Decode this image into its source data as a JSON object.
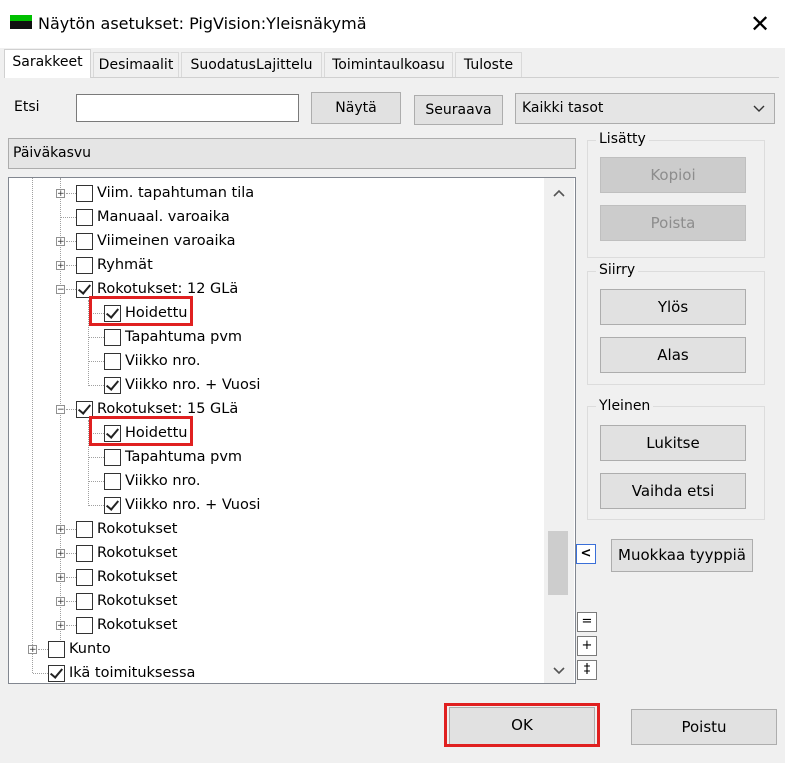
{
  "window": {
    "title": "Näytön asetukset: PigVision:Yleisnäkymä",
    "close_glyph": "✕"
  },
  "tabs": [
    {
      "label": "Sarakkeet"
    },
    {
      "label": "Desimaalit"
    },
    {
      "label": "SuodatusLajittelu"
    },
    {
      "label": "Toimintaulkoasu"
    },
    {
      "label": "Tuloste"
    }
  ],
  "active_tab": "Sarakkeet",
  "search": {
    "label": "Etsi",
    "value": "",
    "show_label": "Näytä",
    "next_label": "Seuraava",
    "level_value": "Kaikki tasot"
  },
  "group_header": "Päiväkasvu",
  "tree": {
    "items": [
      {
        "label": "Viim. tapahtuman tila",
        "checked": false,
        "expandable": true
      },
      {
        "label": "Manuaal. varoaika",
        "checked": false,
        "expandable": false
      },
      {
        "label": "Viimeinen varoaika",
        "checked": false,
        "expandable": true
      },
      {
        "label": "Ryhmät",
        "checked": false,
        "expandable": true
      },
      {
        "label": "Rokotukset: 12 GLä",
        "checked": true,
        "expandable": true,
        "expanded": true
      },
      {
        "label": "Hoidettu",
        "checked": true,
        "highlighted": true
      },
      {
        "label": "Tapahtuma pvm",
        "checked": false
      },
      {
        "label": "Viikko nro.",
        "checked": false
      },
      {
        "label": "Viikko nro. + Vuosi",
        "checked": true
      },
      {
        "label": "Rokotukset: 15 GLä",
        "checked": true,
        "expandable": true,
        "expanded": true
      },
      {
        "label": "Hoidettu",
        "checked": true,
        "highlighted": true
      },
      {
        "label": "Tapahtuma pvm",
        "checked": false
      },
      {
        "label": "Viikko nro.",
        "checked": false
      },
      {
        "label": "Viikko nro. + Vuosi",
        "checked": true
      },
      {
        "label": "Rokotukset",
        "checked": false,
        "expandable": true
      },
      {
        "label": "Rokotukset",
        "checked": false,
        "expandable": true
      },
      {
        "label": "Rokotukset",
        "checked": false,
        "expandable": true
      },
      {
        "label": "Rokotukset",
        "checked": false,
        "expandable": true
      },
      {
        "label": "Rokotukset",
        "checked": false,
        "expandable": true
      },
      {
        "label": "Kunto",
        "checked": false,
        "expandable": true
      },
      {
        "label": "Ikä toimituksessa",
        "checked": true,
        "expandable": false
      }
    ]
  },
  "added_group": {
    "title": "Lisätty",
    "copy_label": "Kopioi",
    "delete_label": "Poista"
  },
  "move_group": {
    "title": "Siirry",
    "up_label": "Ylös",
    "down_label": "Alas"
  },
  "general_group": {
    "title": "Yleinen",
    "lock_label": "Lukitse",
    "switch_label": "Vaihda etsi"
  },
  "collapse_glyph": "<",
  "edit_type_label": "Muokkaa tyyppiä",
  "tree_ctrl": {
    "equal": "=",
    "plus": "+",
    "expand": "‡"
  },
  "footer": {
    "ok_label": "OK",
    "exit_label": "Poistu"
  },
  "colors": {
    "highlight": "#e02020",
    "window_bg": "#f0f0f0"
  }
}
